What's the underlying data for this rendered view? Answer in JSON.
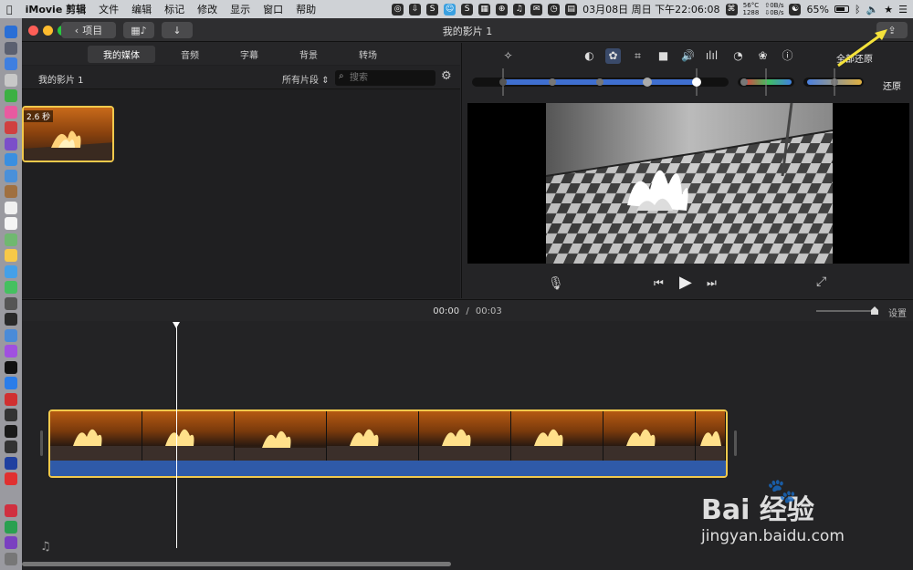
{
  "menubar": {
    "app_name": "iMovie 剪辑",
    "menus": [
      "文件",
      "编辑",
      "标记",
      "修改",
      "显示",
      "窗口",
      "帮助"
    ],
    "temp": "56°C",
    "fan": "1288",
    "net_up": "0B/s",
    "net_down": "0B/s",
    "date": "03月08日 周日 下午22:06:08",
    "battery": "65%"
  },
  "window": {
    "title": "我的影片 1",
    "back_label": "项目",
    "colors": {
      "accent": "#f2c94c",
      "traffic_red": "#fe5f57",
      "traffic_yellow": "#febc2e",
      "traffic_green": "#28c840"
    }
  },
  "browser": {
    "tabs": [
      "我的媒体",
      "音频",
      "字幕",
      "背景",
      "转场"
    ],
    "active_tab": 0,
    "library_name": "我的影片 1",
    "filter_label": "所有片段",
    "search_placeholder": "搜索",
    "clip_duration": "2.6 秒"
  },
  "inspector": {
    "reset_all_label": "全部还原",
    "reset_label": "还原",
    "tools": [
      "magic-wand-icon",
      "color-balance-icon",
      "color-correction-icon",
      "crop-icon",
      "stabilization-icon",
      "volume-icon",
      "equalizer-icon",
      "speed-icon",
      "filter-icon",
      "info-icon"
    ]
  },
  "timeline": {
    "current_time": "00:00",
    "separator": "/",
    "total_time": "00:03",
    "settings_label": "设置"
  },
  "watermark": {
    "brand": "Bai 经验",
    "url": "jingyan.baidu.com"
  }
}
